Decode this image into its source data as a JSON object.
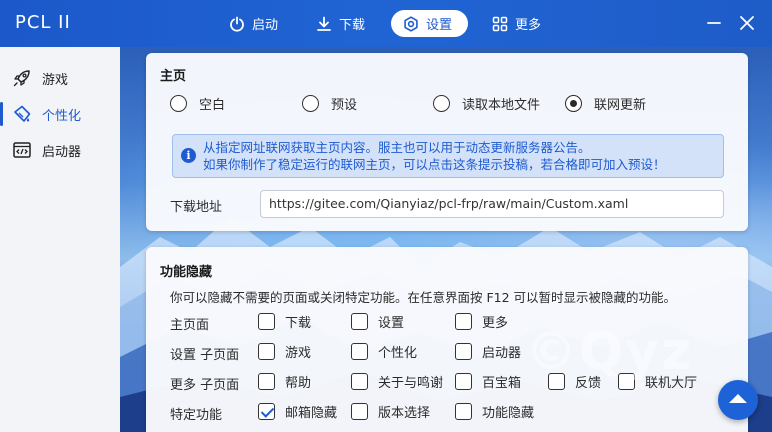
{
  "app": {
    "title": "PCL II"
  },
  "nav": [
    {
      "label": "启动"
    },
    {
      "label": "下载"
    },
    {
      "label": "设置",
      "active": true
    },
    {
      "label": "更多"
    }
  ],
  "sidebar": [
    {
      "label": "游戏"
    },
    {
      "label": "个性化",
      "active": true
    },
    {
      "label": "启动器"
    }
  ],
  "homepage": {
    "title": "主页",
    "options": [
      "空白",
      "预设",
      "读取本地文件",
      "联网更新"
    ],
    "selected": "联网更新",
    "info_line1": "从指定网址联网获取主页内容。服主也可以用于动态更新服务器公告。",
    "info_line2": "如果你制作了稳定运行的联网主页，可以点击这条提示投稿，若合格即可加入预设！",
    "url_label": "下载地址",
    "url_value": "https://gitee.com/Qianyiaz/pcl-frp/raw/main/Custom.xaml"
  },
  "hide": {
    "title": "功能隐藏",
    "desc": "你可以隐藏不需要的页面或关闭特定功能。在任意界面按 F12 可以暂时显示被隐藏的功能。",
    "rows": [
      {
        "label": "主页面",
        "items": [
          {
            "label": "下载",
            "checked": false
          },
          {
            "label": "设置",
            "checked": false
          },
          {
            "label": "更多",
            "checked": false
          }
        ]
      },
      {
        "label": "设置 子页面",
        "items": [
          {
            "label": "游戏",
            "checked": false
          },
          {
            "label": "个性化",
            "checked": false
          },
          {
            "label": "启动器",
            "checked": false
          }
        ]
      },
      {
        "label": "更多 子页面",
        "items": [
          {
            "label": "帮助",
            "checked": false
          },
          {
            "label": "关于与鸣谢",
            "checked": false
          },
          {
            "label": "百宝箱",
            "checked": false
          },
          {
            "label": "反馈",
            "checked": false
          },
          {
            "label": "联机大厅",
            "checked": false
          }
        ]
      },
      {
        "label": "特定功能",
        "items": [
          {
            "label": "邮箱隐藏",
            "checked": true
          },
          {
            "label": "版本选择",
            "checked": false
          },
          {
            "label": "功能隐藏",
            "checked": false
          }
        ]
      }
    ]
  },
  "watermark": "©Qyz",
  "colors": {
    "accent": "#1e5bd0",
    "titlebar": "#2064d3"
  }
}
